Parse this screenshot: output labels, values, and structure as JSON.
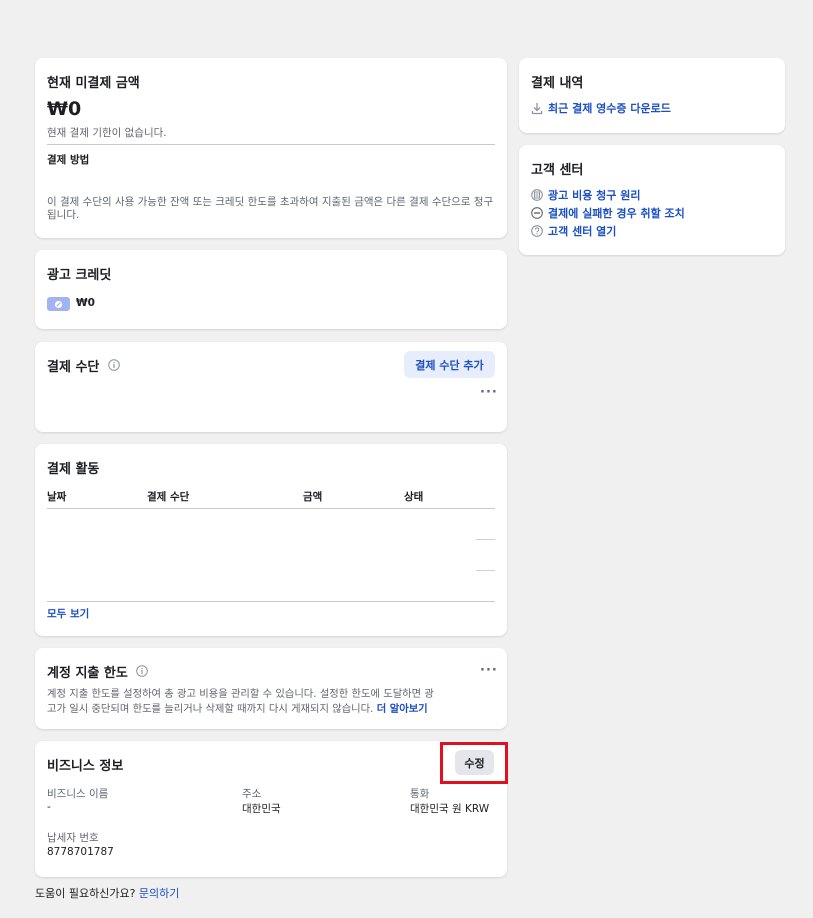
{
  "current_balance": {
    "title": "현재 미결제 금액",
    "amount": "₩0",
    "due_note": "현재 결제 기한이 없습니다.",
    "payment_method_label": "결제 방법",
    "note": "이 결제 수단의 사용 가능한 잔액 또는 크레딧 한도를 초과하여 지출된 금액은 다른 결제 수단으로 청구됩니다."
  },
  "ad_credit": {
    "title": "광고 크레딧",
    "amount": "₩0"
  },
  "payment_methods": {
    "title": "결제 수단",
    "add_button": "결제 수단 추가"
  },
  "payment_activity": {
    "title": "결제 활동",
    "columns": [
      "날짜",
      "결제 수단",
      "금액",
      "상태"
    ],
    "see_all": "모두 보기"
  },
  "spending_limit": {
    "title": "계정 지출 한도",
    "description_line1": "계정 지출 한도를 설정하여 총 광고 비용을 관리할 수 있습니다. 설정한 한도에 도달하면 광",
    "description_line2": "고가 일시 중단되며 한도를 늘리거나 삭제할 때까지 다시 게재되지 않습니다.",
    "learn_more": "더 알아보기"
  },
  "business_info": {
    "title": "비즈니스 정보",
    "edit_button": "수정",
    "name_label": "비즈니스 이름",
    "name_value": "-",
    "address_label": "주소",
    "address_value": "대한민국",
    "currency_label": "통화",
    "currency_value": "대한민국 원 KRW",
    "tax_id_label": "납세자 번호",
    "tax_id_value": "8778701787"
  },
  "help_footer": {
    "text": "도움이 필요하신가요?",
    "link": "문의하기"
  },
  "billing_history": {
    "title": "결제 내역",
    "download_link": "최근 결제 영수증 다운로드"
  },
  "help_center": {
    "title": "고객 센터",
    "links": [
      {
        "label": "광고 비용 청구 원리",
        "icon": "receipt-icon"
      },
      {
        "label": "결제에 실패한 경우 취할 조치",
        "icon": "minus-circle-icon"
      },
      {
        "label": "고객 센터 열기",
        "icon": "question-circle-icon"
      }
    ]
  },
  "colors": {
    "link": "#1d4fc4",
    "highlight": "#e0101e",
    "button_blue_bg": "#e7edfa",
    "button_gray_bg": "#e4e6eb",
    "credit_badge": "#a3b2f0"
  }
}
